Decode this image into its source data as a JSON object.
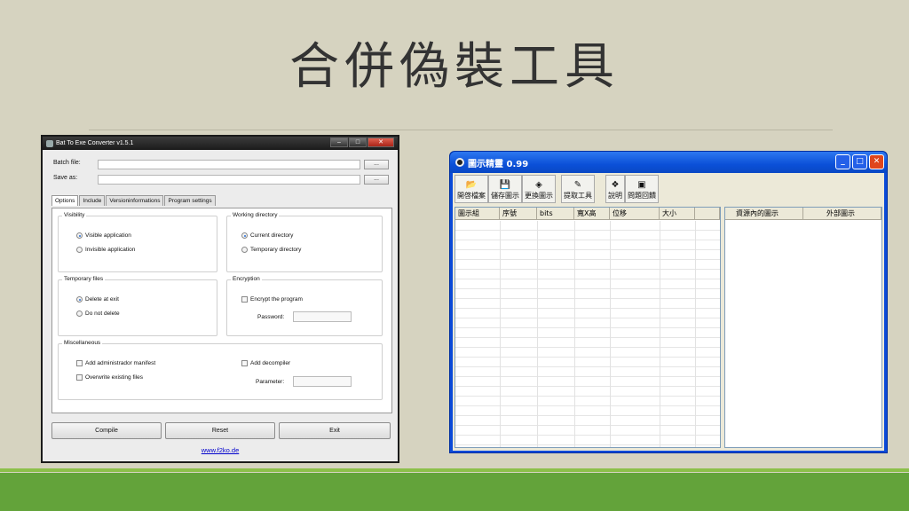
{
  "slide": {
    "title": "合併偽裝工具"
  },
  "bat_to_exe": {
    "window_title": "Bat To Exe Converter v1.5.1",
    "batch_file_label": "Batch file:",
    "save_as_label": "Save as:",
    "browse_label": "...",
    "tabs": [
      "Options",
      "Include",
      "Versioninformations",
      "Program settings"
    ],
    "visibility": {
      "label": "Visibility",
      "options": [
        "Visible application",
        "Invisible application"
      ]
    },
    "working_directory": {
      "label": "Working directory",
      "options": [
        "Current directory",
        "Temporary directory"
      ]
    },
    "temporary_files": {
      "label": "Temporary files",
      "options": [
        "Delete at exit",
        "Do not delete"
      ]
    },
    "encryption": {
      "label": "Encryption",
      "checkbox": "Encrypt the program",
      "password_label": "Password:"
    },
    "misc": {
      "label": "Miscellaneous",
      "add_manifest": "Add administrador manifest",
      "overwrite": "Overwrite existing files",
      "add_decompiler": "Add decompiler",
      "parameter_label": "Parameter:"
    },
    "buttons": {
      "compile": "Compile",
      "reset": "Reset",
      "exit": "Exit"
    },
    "link": "www.f2ko.de"
  },
  "icon_extractor": {
    "window_title": "圖示精靈 0.99",
    "toolbar": [
      "開啓檔案",
      "儲存圖示",
      "更換圖示",
      "提取工具",
      "說明",
      "問題回饋"
    ],
    "left_columns": [
      "圖示組",
      "序號",
      "bits",
      "寬X高",
      "位移",
      "大小"
    ],
    "right_columns": [
      "資源內的圖示",
      "外部圖示"
    ]
  },
  "colors": {
    "accent_green": "#63a33a",
    "xp_blue": "#0a4ad8"
  }
}
